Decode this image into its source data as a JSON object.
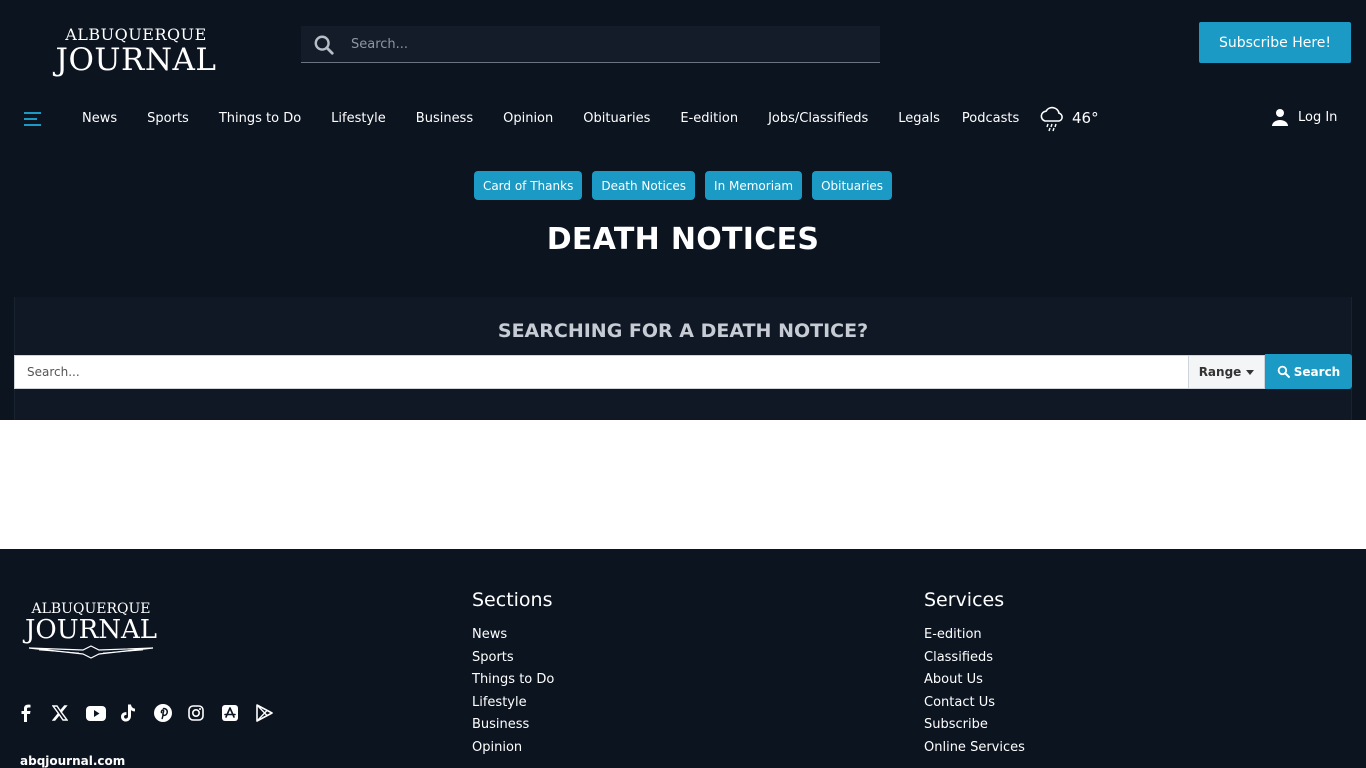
{
  "header": {
    "logo_line1": "ALBUQUERQUE",
    "logo_line2": "JOURNAL",
    "search_placeholder": "Search...",
    "subscribe_label": "Subscribe Here!",
    "menu_icon": "hamburger-icon"
  },
  "nav": {
    "items": [
      "News",
      "Sports",
      "Things to Do",
      "Lifestyle",
      "Business",
      "Opinion",
      "Obituaries",
      "E-edition",
      "Jobs/Classifieds",
      "Legals",
      "Podcasts"
    ],
    "weather_icon": "rain-cloud-icon",
    "weather_temp": "46°",
    "login_label": "Log In"
  },
  "chips": [
    "Card of Thanks",
    "Death Notices",
    "In Memoriam",
    "Obituaries"
  ],
  "page_title": "DEATH NOTICES",
  "notice_search": {
    "title": "SEARCHING FOR A DEATH NOTICE?",
    "placeholder": "Search...",
    "range_label": "Range",
    "button_label": "Search"
  },
  "footer": {
    "logo_line1": "ALBUQUERQUE",
    "logo_line2": "JOURNAL",
    "socials": [
      "facebook-icon",
      "x-icon",
      "youtube-icon",
      "tiktok-icon",
      "pinterest-icon",
      "instagram-icon",
      "app-store-icon",
      "google-play-icon"
    ],
    "site_url": "abqjournal.com",
    "sections_title": "Sections",
    "sections": [
      "News",
      "Sports",
      "Things to Do",
      "Lifestyle",
      "Business",
      "Opinion"
    ],
    "services_title": "Services",
    "services": [
      "E-edition",
      "Classifieds",
      "About Us",
      "Contact Us",
      "Subscribe",
      "Online Services"
    ]
  },
  "colors": {
    "background": "#0c1420",
    "accent": "#1a9ac4"
  }
}
